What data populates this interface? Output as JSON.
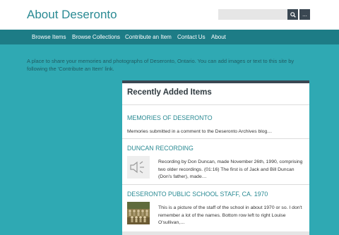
{
  "site": {
    "title": "About Deseronto"
  },
  "search": {
    "placeholder": "",
    "more_label": "..."
  },
  "nav": [
    {
      "label": "Browse Items"
    },
    {
      "label": "Browse Collections"
    },
    {
      "label": "Contribute an Item"
    },
    {
      "label": "Contact Us"
    },
    {
      "label": "About"
    }
  ],
  "intro": "A place to share your memories and photographs of Deseronto, Ontario. You can add images or text to this site by following the 'Contribute an Item' link.",
  "recent": {
    "heading": "Recently Added Items",
    "items": [
      {
        "title": "MEMORIES OF DESERONTO",
        "desc": "Memories submitted in a comment to the Deseronto Archives blog…",
        "thumb": "none"
      },
      {
        "title": "DUNCAN RECORDING",
        "desc": "Recording by Don Duncan, made November 26th, 1990, comprising two older recordings. (01:16) The first is of Jack and Bill Duncan (Don's father), made…",
        "thumb": "speaker-icon"
      },
      {
        "title": "DESERONTO PUBLIC SCHOOL STAFF, CA. 1970",
        "desc": "This is a picture of the staff of the school in about 1970 or so. I don't remember a lot of the names. Bottom row left to right Louise O'sullivan,…",
        "thumb": "photo"
      }
    ]
  },
  "colors": {
    "page_bg": "#2fa9b3",
    "nav_bg": "#1d7c86",
    "accent": "#2a8a93",
    "dark": "#3a4752"
  }
}
